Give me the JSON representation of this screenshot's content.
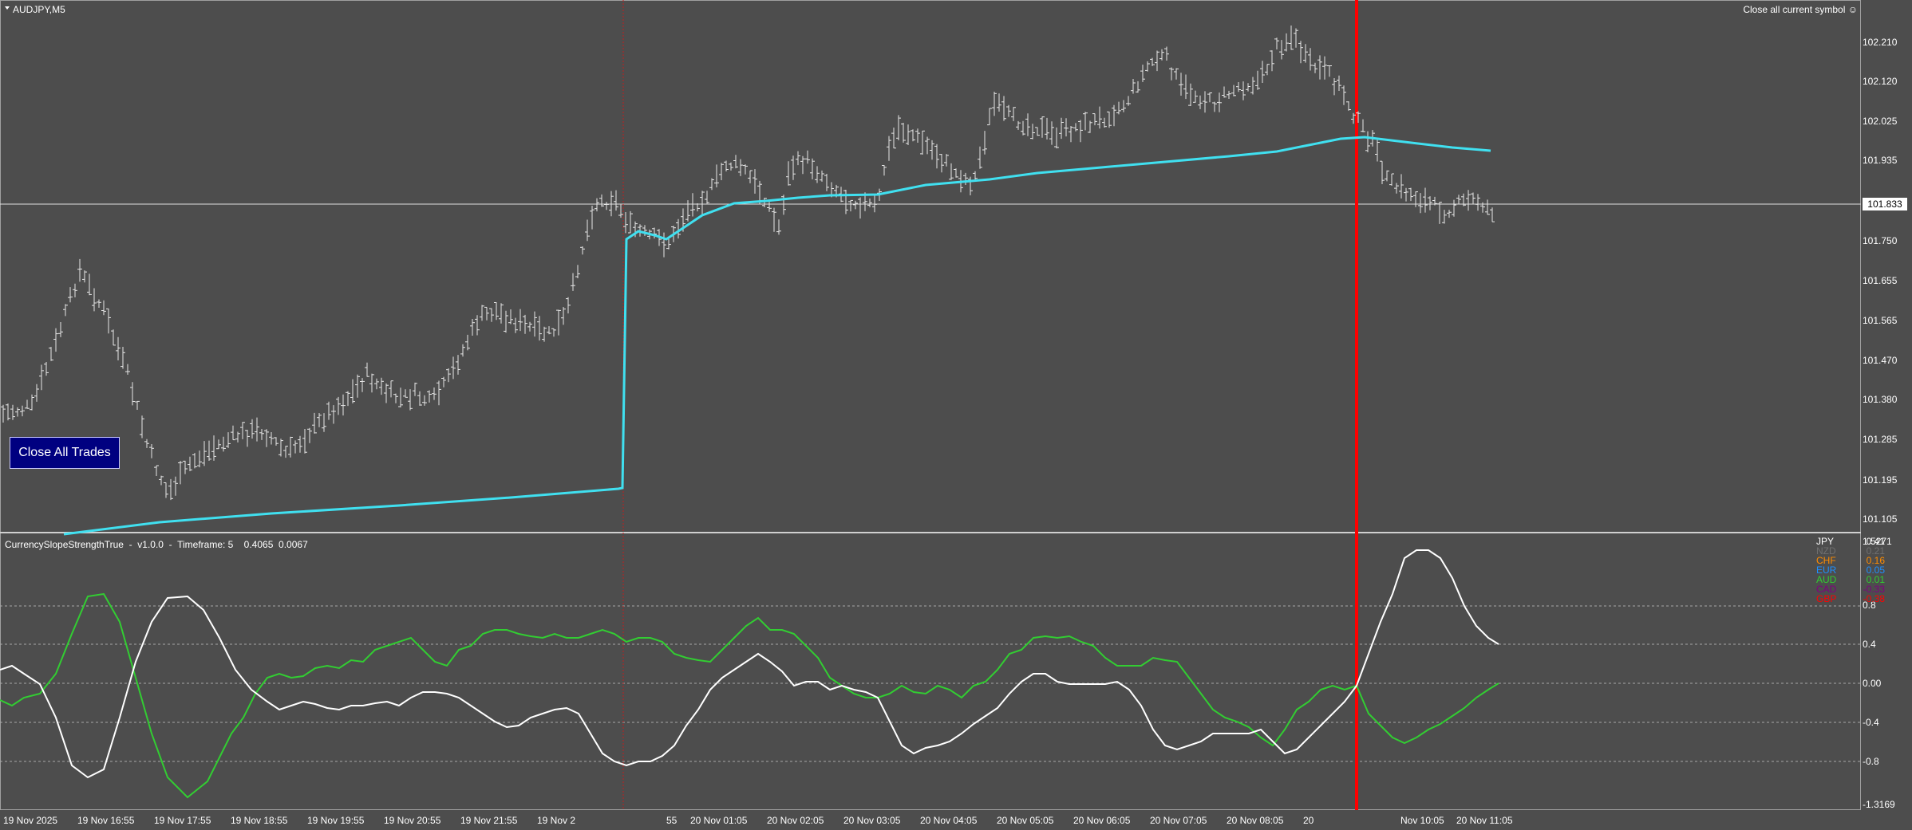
{
  "header": {
    "symbol": "AUDJPY,M5",
    "close_symbol_label": "Close all current symbol",
    "close_all_button": "Close All Trades"
  },
  "price_axis": {
    "labels": [
      "102.210",
      "102.120",
      "102.025",
      "101.935",
      "101.750",
      "101.655",
      "101.565",
      "101.470",
      "101.380",
      "101.285",
      "101.195",
      "101.105"
    ],
    "current_price": "101.833"
  },
  "indicator": {
    "title": "CurrencySlopeStrengthTrue  -  v1.0.0  -  Timeframe: 5    0.4065  0.0067",
    "axis_labels": [
      "1.5271",
      "0.8",
      "0.4",
      "0.00",
      "-0.4",
      "-0.8",
      "-1.3169"
    ],
    "legend": [
      {
        "currency": "JPY",
        "value": "0.41",
        "color": "#ffffff"
      },
      {
        "currency": "NZD",
        "value": "0.21",
        "color": "#707070"
      },
      {
        "currency": "CHF",
        "value": "0.16",
        "color": "#ff8c00"
      },
      {
        "currency": "EUR",
        "value": "0.05",
        "color": "#1e90ff"
      },
      {
        "currency": "AUD",
        "value": "0.01",
        "color": "#32cd32"
      },
      {
        "currency": "CAD",
        "value": "-0.33",
        "color": "#800080"
      },
      {
        "currency": "GBP",
        "value": "-0.38",
        "color": "#ff0000"
      }
    ]
  },
  "time_axis": [
    "19 Nov 2025",
    "19 Nov 16:55",
    "19 Nov 17:55",
    "19 Nov 18:55",
    "19 Nov 19:55",
    "19 Nov 20:55",
    "19 Nov 21:55",
    "19 Nov 2",
    "55",
    "20 Nov 01:05",
    "20 Nov 02:05",
    "20 Nov 03:05",
    "20 Nov 04:05",
    "20 Nov 05:05",
    "20 Nov 06:05",
    "20 Nov 07:05",
    "20 Nov 08:05",
    "20",
    "Nov 10:05",
    "20 Nov 11:05"
  ],
  "colors": {
    "background": "#4d4d4d",
    "moving_average": "#40e0f0",
    "aud_line": "#32cd32",
    "jpy_line": "#ffffff",
    "event_line": "#ff0000"
  }
}
